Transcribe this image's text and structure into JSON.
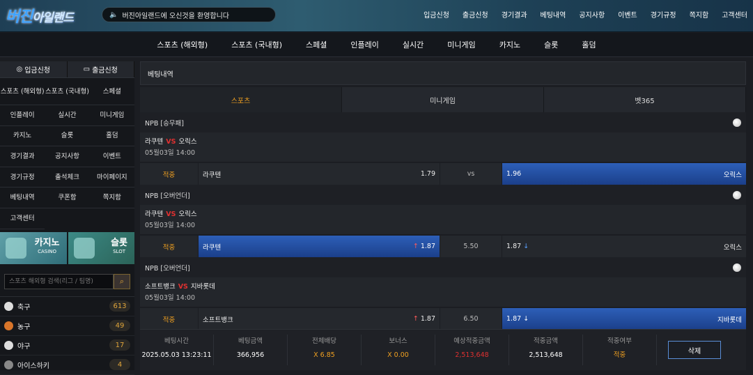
{
  "logo": {
    "main": "버진",
    "sub": "아일랜드"
  },
  "marquee": "버진아일랜드에 오신것을 환영합니다",
  "topnav": [
    "입금신청",
    "출금신청",
    "경기결과",
    "베팅내역",
    "공지사항",
    "이벤트",
    "경기규정",
    "쪽지함",
    "고객센터"
  ],
  "mainnav": [
    "스포츠 (해외형)",
    "스포츠 (국내형)",
    "스페셜",
    "인플레이",
    "실시간",
    "미니게임",
    "카지노",
    "슬롯",
    "홀덤"
  ],
  "sidebar": {
    "deposit": "입금신청",
    "withdraw": "출금신청",
    "menu": [
      "스포츠 (해외형)",
      "스포츠 (국내형)",
      "스페셜",
      "인플레이",
      "실시간",
      "미니게임",
      "카지노",
      "슬롯",
      "홀덤",
      "경기결과",
      "공지사항",
      "이벤트",
      "경기규정",
      "출석체크",
      "마이페이지",
      "베팅내역",
      "쿠폰함",
      "쪽지함",
      "고객센터"
    ],
    "casino": {
      "title": "카지노",
      "sub": "CASINO"
    },
    "slot": {
      "title": "슬롯",
      "sub": "SLOT"
    },
    "search_placeholder": "스포츠 해외형 검색(리그 / 팀명)",
    "sports": [
      {
        "name": "축구",
        "count": "613"
      },
      {
        "name": "농구",
        "count": "49"
      },
      {
        "name": "야구",
        "count": "17"
      },
      {
        "name": "아이스하키",
        "count": "4"
      }
    ]
  },
  "content": {
    "title": "베팅내역",
    "tabs": [
      "스포츠",
      "미니게임",
      "벳365"
    ],
    "bets": [
      {
        "league": "NPB [승무패]",
        "home": "라쿠텐",
        "vs": "VS",
        "away": "오릭스",
        "date": "05월03일 14:00",
        "status": "적중",
        "home_odds": "1.79",
        "mid": "vs",
        "away_odds": "1.96",
        "selected": "away"
      },
      {
        "league": "NPB [오버언더]",
        "home": "라쿠텐",
        "vs": "VS",
        "away": "오릭스",
        "date": "05월03일 14:00",
        "status": "적중",
        "home_odds": "1.87",
        "mid": "5.50",
        "away_odds": "1.87",
        "selected": "home"
      },
      {
        "league": "NPB [오버언더]",
        "home": "소프트뱅크",
        "vs": "VS",
        "away": "지바롯데",
        "date": "05월03일 14:00",
        "status": "적중",
        "home_odds": "1.87",
        "mid": "6.50",
        "away_odds": "1.87",
        "selected": "away"
      }
    ],
    "summary": [
      {
        "label": "베팅시간",
        "value": "2025.05.03 13:23:11"
      },
      {
        "label": "베팅금액",
        "value": "366,956"
      },
      {
        "label": "전체배당",
        "value": "X 6.85"
      },
      {
        "label": "보너스",
        "value": "X 0.00"
      },
      {
        "label": "예상적중금액",
        "value": "2,513,648"
      },
      {
        "label": "적중금액",
        "value": "2,513,648"
      },
      {
        "label": "적중여부",
        "value": "적중"
      }
    ],
    "delete_label": "삭제"
  }
}
